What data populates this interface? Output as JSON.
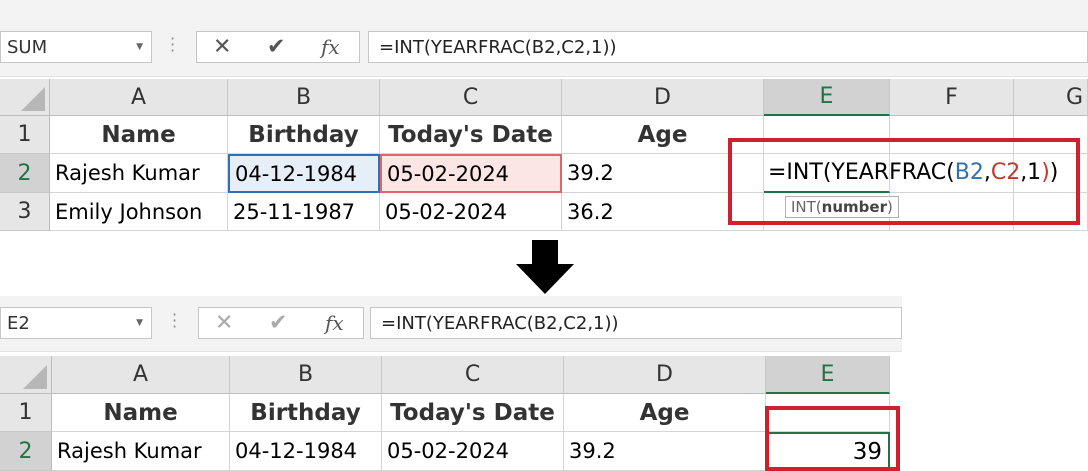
{
  "top": {
    "name_box": "SUM",
    "formula": "=INT(YEARFRAC(B2,C2,1))",
    "columns": [
      "A",
      "B",
      "C",
      "D",
      "E",
      "F",
      "G"
    ],
    "rows": [
      "1",
      "2",
      "3"
    ],
    "headers": [
      "Name",
      "Birthday",
      "Today's Date",
      "Age"
    ],
    "data": [
      [
        "Rajesh Kumar",
        "04-12-1984",
        "05-02-2024",
        "39.2"
      ],
      [
        "Emily Johnson",
        "25-11-1987",
        "05-02-2024",
        "36.2"
      ]
    ],
    "edit_formula": {
      "part1": "=INT(YEARFRAC(",
      "ref1": "B2",
      "comma1": ",",
      "ref2": "C2",
      "part2": ",1",
      "close1": ")",
      "close2": ")"
    },
    "tooltip": {
      "fn": "INT(",
      "arg": "number",
      "close": ")"
    }
  },
  "arrow_icon": "down-arrow-icon",
  "bottom": {
    "name_box": "E2",
    "formula": "=INT(YEARFRAC(B2,C2,1))",
    "columns": [
      "A",
      "B",
      "C",
      "D",
      "E"
    ],
    "rows": [
      "1",
      "2"
    ],
    "headers": [
      "Name",
      "Birthday",
      "Today's Date",
      "Age"
    ],
    "data": [
      [
        "Rajesh Kumar",
        "04-12-1984",
        "05-02-2024",
        "39.2",
        "39"
      ]
    ]
  },
  "colors": {
    "accent_green": "#217346",
    "highlight_red": "#d0202e",
    "ref_blue": "#2f6fb3",
    "ref_red": "#c0392b"
  }
}
